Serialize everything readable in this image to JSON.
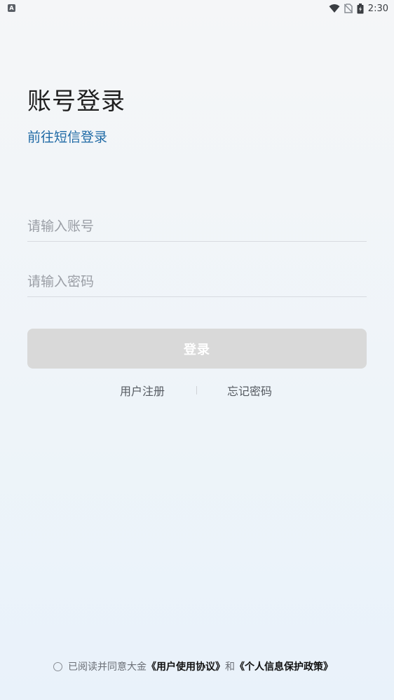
{
  "status_bar": {
    "time": "2:30",
    "left_badge": "A",
    "icons": [
      "wifi-icon",
      "no-sim-icon",
      "battery-charging-icon"
    ]
  },
  "header": {
    "title": "账号登录",
    "sms_link": "前往短信登录"
  },
  "form": {
    "account_placeholder": "请输入账号",
    "password_placeholder": "请输入密码",
    "login_label": "登录"
  },
  "links": {
    "register": "用户注册",
    "forgot": "忘记密码"
  },
  "agreement": {
    "prefix": "已阅读并同意大金",
    "user_agreement": "《用户使用协议》",
    "and": "和",
    "privacy_policy": "《个人信息保护政策》"
  },
  "colors": {
    "link": "#1f6aa5",
    "button_disabled": "#d9d9d9"
  }
}
